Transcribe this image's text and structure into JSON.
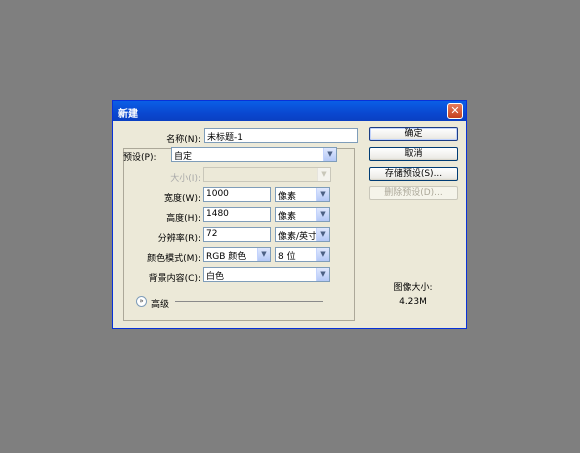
{
  "dialog": {
    "title": "新建",
    "close_label": "✕",
    "name_label": "名称(N):",
    "name_value": "未标题-1",
    "preset_label": "预设(P):",
    "preset_value": "自定",
    "size_label": "大小(I):",
    "size_value": "",
    "width_label": "宽度(W):",
    "width_value": "1000",
    "width_unit": "像素",
    "height_label": "高度(H):",
    "height_value": "1480",
    "height_unit": "像素",
    "resolution_label": "分辨率(R):",
    "resolution_value": "72",
    "resolution_unit": "像素/英寸",
    "color_mode_label": "颜色模式(M):",
    "color_mode_value": "RGB 颜色",
    "bit_depth_value": "8 位",
    "background_label": "背景内容(C):",
    "background_value": "白色",
    "advanced_label": "高级",
    "image_size_label": "图像大小:",
    "image_size_value": "4.23M"
  },
  "buttons": {
    "ok": "确定",
    "cancel": "取消",
    "save_preset": "存储预设(S)...",
    "delete_preset": "删除预设(D)..."
  },
  "colors": {
    "desktop": "#7f7f7f",
    "dialog_bg": "#ece9d8",
    "titlebar": "#0a48d0",
    "close_button": "#c5401f"
  },
  "icons": {
    "close": "close-icon",
    "dropdown": "chevron-down-icon",
    "advanced_toggle": "double-chevron-down-icon"
  }
}
